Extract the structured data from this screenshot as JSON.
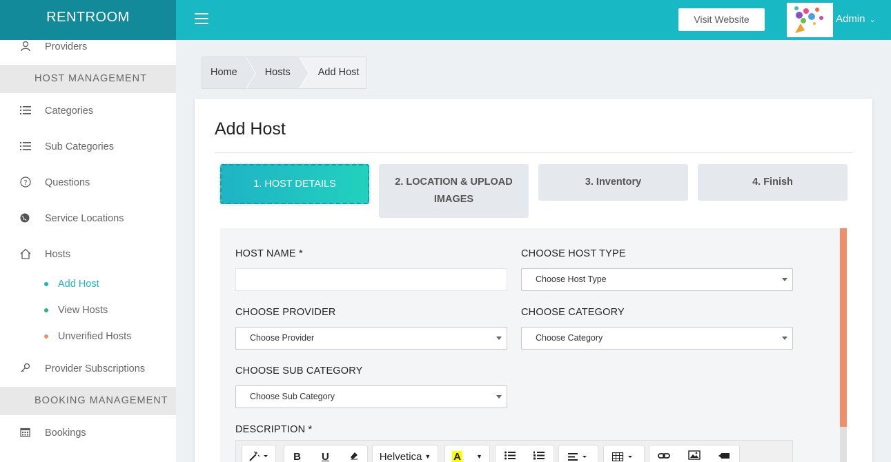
{
  "brand": "RENTROOM",
  "header": {
    "visit_label": "Visit Website",
    "user_label": "Admin"
  },
  "sidebar": {
    "providers": "Providers",
    "host_section": "HOST MANAGEMENT",
    "categories": "Categories",
    "sub_categories": "Sub Categories",
    "questions": "Questions",
    "service_locations": "Service Locations",
    "hosts": "Hosts",
    "add_host": "Add Host",
    "view_hosts": "View Hosts",
    "unverified_hosts": "Unverified Hosts",
    "provider_subscriptions": "Provider Subscriptions",
    "booking_section": "BOOKING MANAGEMENT",
    "bookings": "Bookings",
    "colors": {
      "add_host": "#1fb3c6",
      "view_hosts": "#22b58a",
      "unverified_hosts": "#f08f6c"
    }
  },
  "breadcrumb": [
    "Home",
    "Hosts",
    "Add Host"
  ],
  "page_title": "Add Host",
  "steps": [
    {
      "label": "1. HOST DETAILS",
      "active": true
    },
    {
      "label": "2. LOCATION & UPLOAD IMAGES",
      "active": false
    },
    {
      "label": "3. Inventory",
      "active": false
    },
    {
      "label": "4. Finish",
      "active": false
    }
  ],
  "form": {
    "host_name_label": "HOST NAME *",
    "host_name_value": "",
    "host_type_label": "CHOOSE HOST TYPE",
    "host_type_value": "Choose Host Type",
    "provider_label": "CHOOSE PROVIDER",
    "provider_value": "Choose Provider",
    "category_label": "CHOOSE CATEGORY",
    "category_value": "Choose Category",
    "sub_category_label": "CHOOSE SUB CATEGORY",
    "sub_category_value": "Choose Sub Category",
    "description_label": "DESCRIPTION *"
  },
  "editor": {
    "font_name": "Helvetica"
  }
}
